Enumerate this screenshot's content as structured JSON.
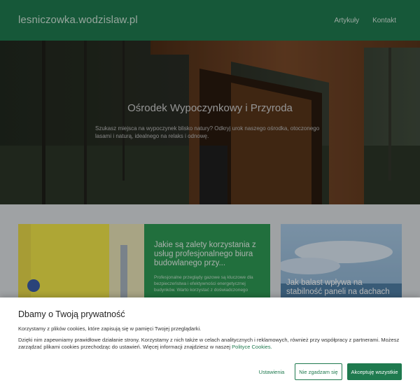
{
  "header": {
    "brand": "lesniczowka.wodzislaw.pl",
    "nav": [
      "Artykuły",
      "Kontakt"
    ]
  },
  "hero": {
    "title": "Ośrodek Wypoczynkowy i Przyroda",
    "text": "Szukasz miejsca na wypoczynek blisko natury? Odkryj urok naszego ośrodka, otoczonego lasami i naturą, idealnego na relaks i odnowę."
  },
  "cards": {
    "middle": {
      "title": "Jakie są zalety korzystania z usług profesjonalnego biura budowlanego przy...",
      "excerpt": "Profesjonalne przeglądy gazowe są kluczowe dla bezpieczeństwa i efektywności energetycznej budynków. Warto korzystać z doświadczonego"
    },
    "right": {
      "title": "Jak balast wpływa na stabilność paneli na dachach"
    }
  },
  "cookie": {
    "title": "Dbamy o Twoją prywatność",
    "p1": "Korzystamy z plików cookies, które zapisują się w pamięci Twojej przeglądarki.",
    "p2": "Dzięki nim zapewniamy prawidłowe działanie strony. Korzystamy z nich także w celach analitycznych i reklamowych, również przy współpracy z partnerami. Możesz zarządzać plikami cookies przechodząc do ustawień. Więcej informacji znajdziesz w naszej",
    "link": "Polityce Cookies.",
    "buttons": {
      "settings": "Ustawienia",
      "reject": "Nie zgadzam się",
      "accept": "Akceptuję wszystkie"
    }
  },
  "colors": {
    "brand_green": "#1f7a4f",
    "card_green": "#2f9a55"
  }
}
